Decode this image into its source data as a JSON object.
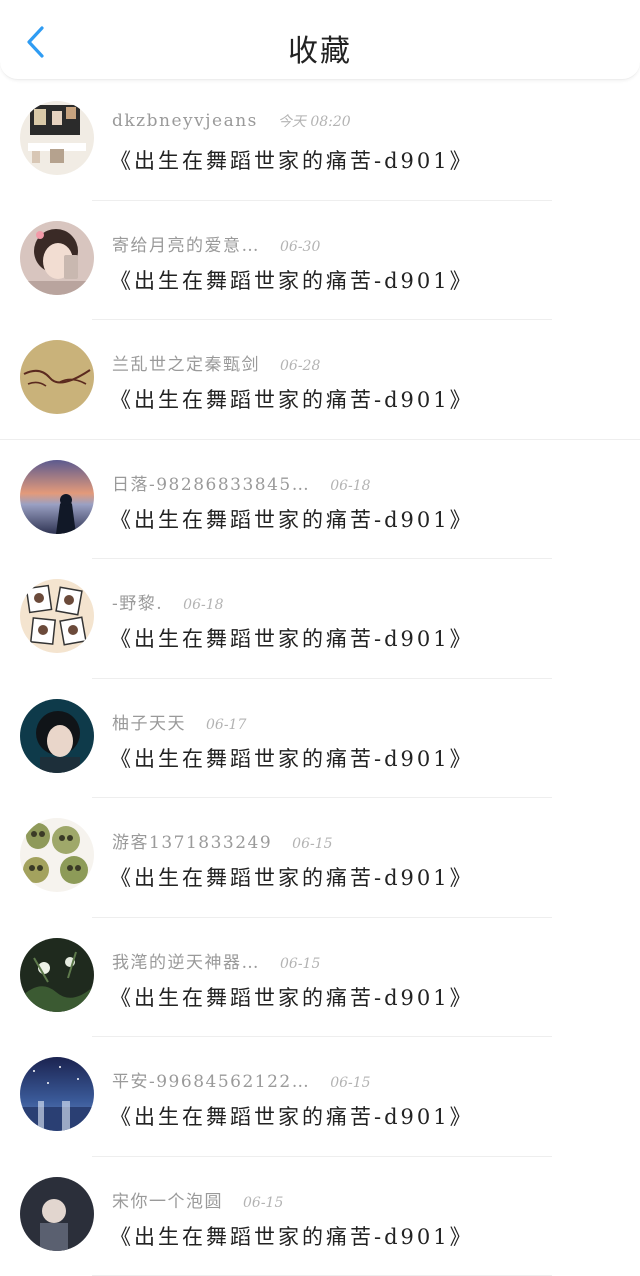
{
  "header": {
    "title": "收藏",
    "back_icon": "chevron-left-icon",
    "accent_color": "#2f9cf3"
  },
  "favorites": [
    {
      "author": "dkzbneyvjeans",
      "time": "今天 08:20",
      "title": "《出生在舞蹈世家的痛苦-d901》"
    },
    {
      "author": "寄给月亮的爱意…",
      "time": "06-30",
      "title": "《出生在舞蹈世家的痛苦-d901》"
    },
    {
      "author": "兰乱世之定秦甄剑",
      "time": "06-28",
      "title": "《出生在舞蹈世家的痛苦-d901》"
    },
    {
      "author": "日落-98286833845…",
      "time": "06-18",
      "title": "《出生在舞蹈世家的痛苦-d901》"
    },
    {
      "author": "-野黎.",
      "time": "06-18",
      "title": "《出生在舞蹈世家的痛苦-d901》"
    },
    {
      "author": "柚子天天",
      "time": "06-17",
      "title": "《出生在舞蹈世家的痛苦-d901》"
    },
    {
      "author": "游客1371833249",
      "time": "06-15",
      "title": "《出生在舞蹈世家的痛苦-d901》"
    },
    {
      "author": "我滗的逆天神器…",
      "time": "06-15",
      "title": "《出生在舞蹈世家的痛苦-d901》"
    },
    {
      "author": "平安-99684562122…",
      "time": "06-15",
      "title": "《出生在舞蹈世家的痛苦-d901》"
    },
    {
      "author": "宋你一个泡圆",
      "time": "06-15",
      "title": "《出生在舞蹈世家的痛苦-d901》"
    }
  ]
}
